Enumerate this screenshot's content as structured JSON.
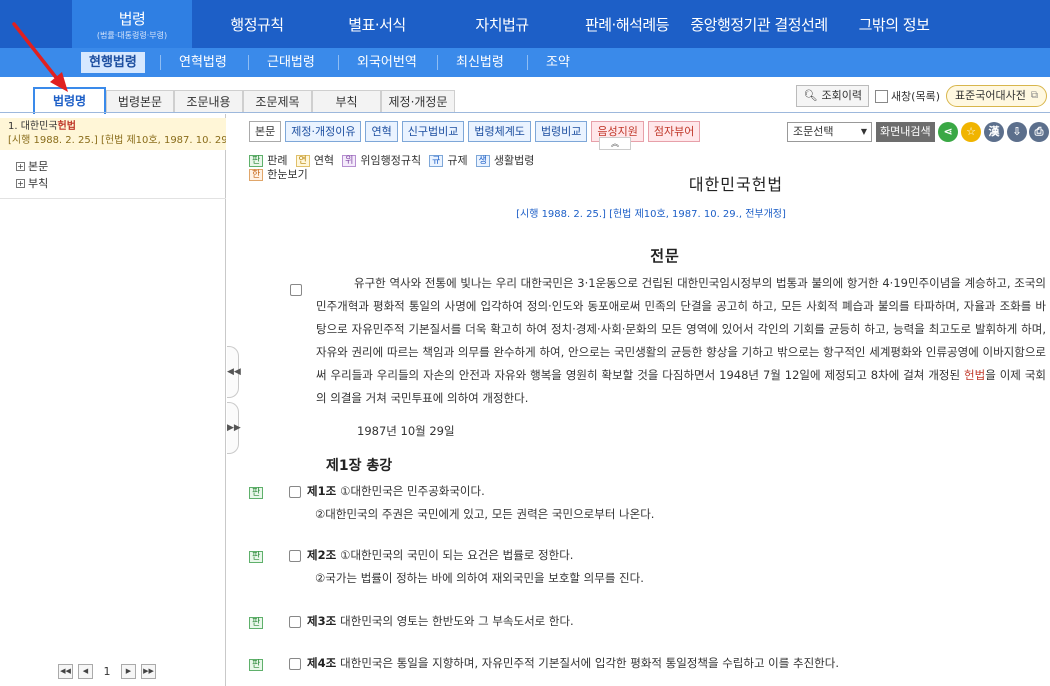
{
  "topnav": {
    "items": [
      {
        "label": "법령",
        "sub": "(법률·대통령령·부령)"
      },
      {
        "label": "행정규칙"
      },
      {
        "label": "별표·서식"
      },
      {
        "label": "자치법규"
      },
      {
        "label": "판례·해석례등"
      },
      {
        "label": "중앙행정기관 결정선례"
      },
      {
        "label": "그밖의 정보"
      }
    ]
  },
  "subnav": {
    "items": [
      "현행법령",
      "연혁법령",
      "근대법령",
      "외국어번역",
      "최신법령",
      "조약"
    ]
  },
  "left_tabs": [
    "법령명",
    "법령본문",
    "조문내용",
    "조문제목",
    "부칙",
    "제정·개정문"
  ],
  "right_tools": {
    "history": "조회이력",
    "new_window": "새창(목록)",
    "dictionary": "표준국어대사전"
  },
  "left_panel": {
    "result_line1_prefix": "1.  대한민국",
    "result_line1_bold": "헌법",
    "result_line2": "[시행 1988. 2. 25.] [헌법 제10호, 1987. 10. 29.",
    "tree": [
      "본문",
      "부칙"
    ],
    "page": "1"
  },
  "content_toolbar": {
    "buttons": [
      "본문",
      "제정·개정이유",
      "연혁",
      "신구법비교",
      "법령체계도",
      "법령비교"
    ],
    "pink_buttons": [
      "음성지원",
      "점자뷰어"
    ],
    "select": "조문선택",
    "search": "화면내검색",
    "hanja": "漢"
  },
  "legend": {
    "row1": [
      {
        "tag": "판",
        "label": "판례"
      },
      {
        "tag": "연",
        "label": "연혁"
      },
      {
        "tag": "위",
        "label": "위임행정규칙"
      },
      {
        "tag": "규",
        "label": "규제"
      },
      {
        "tag": "생",
        "label": "생활법령"
      }
    ],
    "row2": {
      "tag": "한",
      "label": "한눈보기"
    }
  },
  "law": {
    "title": "대한민국헌법",
    "subtitle": "[시행 1988. 2. 25.] [헌법 제10호, 1987. 10. 29., 전부개정]",
    "preamble_title": "전문",
    "preamble_part1": "유구한 역사와 전통에 빛나는 우리 대한국민은 3·1운동으로 건립된 대한민국임시정부의 법통과 불의에 항거한 4·19민주이념을 계승하고, 조국의 민주개혁과 평화적 통일의 사명에 입각하여 정의·인도와 동포애로써 민족의 단결을 공고히 하고, 모든 사회적 폐습과 불의를 타파하며, 자율과 조화를 바탕으로 자유민주적 기본질서를 더욱 확고히 하여 정치·경제·사회·문화의 모든 영역에 있어서 각인의 기회를 균등히 하고, 능력을 최고도로 발휘하게 하며, 자유와 권리에 따르는 책임과 의무를 완수하게 하여, 안으로는 국민생활의 균등한 향상을 기하고 밖으로는 항구적인 세계평화와 인류공영에 이바지함으로써 우리들과 우리들의 자손의 안전과 자유와 행복을 영원히 확보할 것을 다짐하면서 1948년 7월 12일에 제정되고 8차에 걸쳐 개정된 ",
    "preamble_red": "헌법",
    "preamble_part2": "을 이제 국회의 의결을 거쳐 국민투표에 의하여 개정한다.",
    "date": "1987년 10월 29일",
    "chapter": "제1장 총강",
    "articles": [
      {
        "tag": "판",
        "num": "제1조",
        "text": "①대한민국은 민주공화국이다.",
        "text2": "②대한민국의 주권은 국민에게 있고, 모든 권력은 국민으로부터 나온다."
      },
      {
        "tag": "판",
        "num": "제2조",
        "text": "①대한민국의 국민이 되는 요건은 법률로 정한다.",
        "text2": "②국가는 법률이 정하는 바에 의하여 재외국민을 보호할 의무를 진다."
      },
      {
        "tag": "판",
        "num": "제3조",
        "text": "대한민국의 영토는 한반도와 그 부속도서로 한다."
      },
      {
        "tag": "판",
        "num": "제4조",
        "text": "대한민국은 통일을 지향하며, 자유민주적 기본질서에 입각한 평화적 통일정책을 수립하고 이를 추진한다."
      }
    ]
  },
  "colors": {
    "nav": "#1d5fc7",
    "subnav": "#3a8aea",
    "accent_red": "#c0392b"
  }
}
